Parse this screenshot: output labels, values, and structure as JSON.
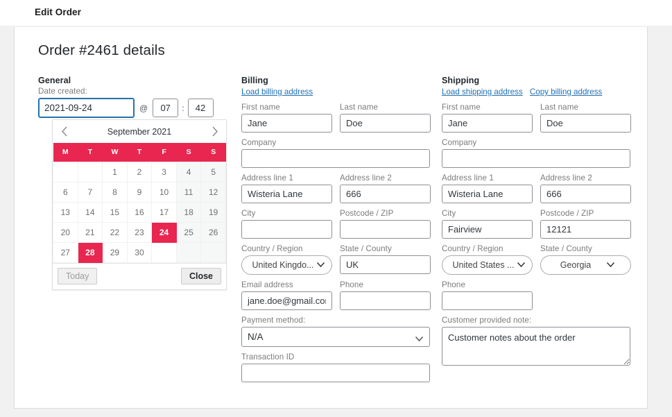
{
  "window": {
    "title": "Edit Order"
  },
  "page": {
    "title": "Order #2461 details"
  },
  "colors": {
    "accent": "#e8264f",
    "link": "#2271b1",
    "focus": "#2271b1"
  },
  "general": {
    "heading": "General",
    "date_created_label": "Date created:",
    "date_value": "2021-09-24",
    "at_symbol": "@",
    "hour_value": "07",
    "colon": ":",
    "minute_value": "42"
  },
  "datepicker": {
    "prev_icon": "chevron-left-icon",
    "next_icon": "chevron-right-icon",
    "month_title": "September 2021",
    "weekdays": [
      "M",
      "T",
      "W",
      "T",
      "F",
      "S",
      "S"
    ],
    "weeks": [
      [
        "",
        "",
        "1",
        "2",
        "3",
        "4",
        "5"
      ],
      [
        "6",
        "7",
        "8",
        "9",
        "10",
        "11",
        "12"
      ],
      [
        "13",
        "14",
        "15",
        "16",
        "17",
        "18",
        "19"
      ],
      [
        "20",
        "21",
        "22",
        "23",
        "24",
        "25",
        "26"
      ],
      [
        "27",
        "28",
        "29",
        "30",
        "",
        "",
        ""
      ]
    ],
    "selected_day": "24",
    "today_day": "28",
    "today_label": "Today",
    "close_label": "Close"
  },
  "billing": {
    "heading": "Billing",
    "links": [
      {
        "label": "Load billing address"
      }
    ],
    "first_name_label": "First name",
    "first_name_value": "Jane",
    "last_name_label": "Last name",
    "last_name_value": "Doe",
    "company_label": "Company",
    "company_value": "",
    "address1_label": "Address line 1",
    "address1_value": "Wisteria Lane",
    "address2_label": "Address line 2",
    "address2_value": "666",
    "city_label": "City",
    "city_value": "",
    "postcode_label": "Postcode / ZIP",
    "postcode_value": "",
    "country_label": "Country / Region",
    "country_value": "United Kingdo...",
    "state_label": "State / County",
    "state_value": "UK",
    "email_label": "Email address",
    "email_value": "jane.doe@gmail.com",
    "phone_label": "Phone",
    "phone_value": "",
    "payment_label": "Payment method:",
    "payment_value": "N/A",
    "transaction_label": "Transaction ID",
    "transaction_value": ""
  },
  "shipping": {
    "heading": "Shipping",
    "links": [
      {
        "label": "Load shipping address"
      },
      {
        "label": "Copy billing address"
      }
    ],
    "first_name_label": "First name",
    "first_name_value": "Jane",
    "last_name_label": "Last name",
    "last_name_value": "Doe",
    "company_label": "Company",
    "company_value": "",
    "address1_label": "Address line 1",
    "address1_value": "Wisteria Lane",
    "address2_label": "Address line 2",
    "address2_value": "666",
    "city_label": "City",
    "city_value": "Fairview",
    "postcode_label": "Postcode / ZIP",
    "postcode_value": "12121",
    "country_label": "Country / Region",
    "country_value": "United States ...",
    "state_label": "State / County",
    "state_value": "Georgia",
    "phone_label": "Phone",
    "phone_value": "",
    "note_label": "Customer provided note:",
    "note_value": "Customer notes about the order"
  }
}
